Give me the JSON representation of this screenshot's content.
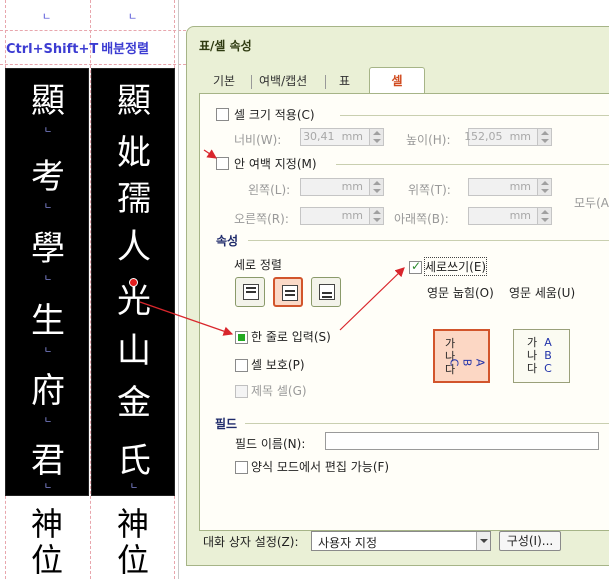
{
  "document": {
    "caption_keys": "Ctrl+Shift+T",
    "caption_cmd": "배분정렬",
    "top_marks": [
      "ㄴ",
      "ㄴ"
    ],
    "left_column_chars": [
      "顯",
      "考",
      "學",
      "生",
      "府",
      "君"
    ],
    "right_column_chars": [
      "顯",
      "妣",
      "孺",
      "人",
      "光",
      "山",
      "金",
      "氏"
    ],
    "para_mark": "ㄴ",
    "bottom_left_chars": [
      "神",
      "位"
    ],
    "bottom_right_chars": [
      "神",
      "位"
    ]
  },
  "dialog": {
    "title": "표/셀 속성",
    "tabs": [
      {
        "label": "기본"
      },
      {
        "label": "여백/캡션"
      },
      {
        "label": "표"
      },
      {
        "label": "셀"
      }
    ],
    "cell_size": {
      "checkbox_label": "셀 크기 적용(C)",
      "width_label": "너비(W):",
      "width_value": "30,41",
      "height_label": "높이(H):",
      "height_value": "152,05",
      "unit": "mm"
    },
    "inner_margin": {
      "checkbox_label": "안 여백 지정(M)",
      "left_label": "왼쪽(L):",
      "right_label": "오른쪽(R):",
      "top_label": "위쪽(T):",
      "bottom_label": "아래쪽(B):",
      "all_label": "모두(A)",
      "unit": "mm"
    },
    "attributes": {
      "section_label": "속성",
      "vertical_align_label": "세로 정렬",
      "single_line_label": "한 줄로 입력(S)",
      "cell_protect_label": "셀 보호(P)",
      "title_cell_label": "제목 셀(G)",
      "vertical_write_label": "세로쓰기(E)",
      "eng_lying_label": "영문 눕힘(O)",
      "eng_standing_label": "영문 세움(U)",
      "kor_sample": [
        "가",
        "나",
        "다"
      ],
      "eng_sample": [
        "A",
        "B",
        "C"
      ]
    },
    "field": {
      "section_label": "필드",
      "name_label": "필드 이름(N):",
      "name_value": "",
      "form_edit_label": "양식 모드에서 편집 가능(F)"
    },
    "bottom": {
      "dialog_setting_label": "대화 상자 설정(Z):",
      "dialog_setting_value": "사용자 지정",
      "config_button": "구성(I)..."
    }
  },
  "colors": {
    "dialog_bg": "#eaf0d6",
    "active_tab_text": "#d04a1e",
    "selected_border": "#d2552c",
    "annotation_arrow": "#d9262c"
  }
}
